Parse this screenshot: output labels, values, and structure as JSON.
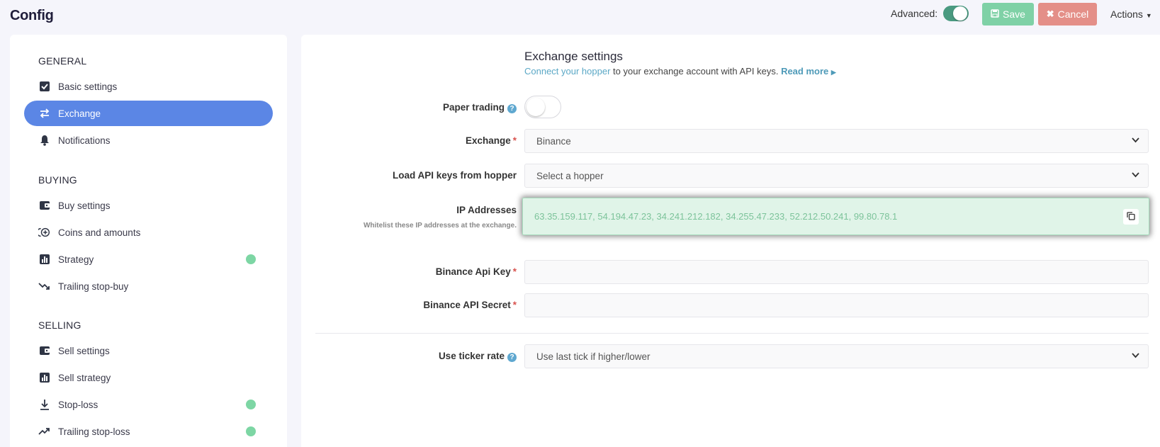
{
  "header": {
    "title": "Config",
    "advanced_label": "Advanced:",
    "save_label": "Save",
    "cancel_label": "Cancel",
    "actions_label": "Actions"
  },
  "sidebar": {
    "general_title": "GENERAL",
    "buying_title": "BUYING",
    "selling_title": "SELLING",
    "items": [
      {
        "label": "Basic settings",
        "icon": "checkbox-icon"
      },
      {
        "label": "Exchange",
        "icon": "swap-arrows-icon",
        "active": true
      },
      {
        "label": "Notifications",
        "icon": "bell-icon"
      },
      {
        "label": "Buy settings",
        "icon": "wallet-icon"
      },
      {
        "label": "Coins and amounts",
        "icon": "coins-plus-icon"
      },
      {
        "label": "Strategy",
        "icon": "bar-chart-icon",
        "status": "green"
      },
      {
        "label": "Trailing stop-buy",
        "icon": "trend-down-icon"
      },
      {
        "label": "Sell settings",
        "icon": "wallet-icon"
      },
      {
        "label": "Sell strategy",
        "icon": "bar-chart-icon"
      },
      {
        "label": "Stop-loss",
        "icon": "download-arrow-icon",
        "status": "green"
      },
      {
        "label": "Trailing stop-loss",
        "icon": "trend-up-icon",
        "status": "green"
      }
    ]
  },
  "main": {
    "title": "Exchange settings",
    "subtitle_link": "Connect your hopper",
    "subtitle_text": " to your exchange account with API keys. ",
    "read_more": "Read more",
    "paper_trading_label": "Paper trading",
    "exchange_label": "Exchange",
    "exchange_value": "Binance",
    "load_keys_label": "Load API keys from hopper",
    "load_keys_placeholder": "Select a hopper",
    "ip_label": "IP Addresses",
    "ip_sublabel": "Whitelist these IP addresses at the exchange.",
    "ip_value": "63.35.159.117, 54.194.47.23, 34.241.212.182, 34.255.47.233, 52.212.50.241, 99.80.78.1",
    "api_key_label": "Binance Api Key",
    "api_key_value": "",
    "api_secret_label": "Binance API Secret",
    "api_secret_value": "",
    "ticker_label": "Use ticker rate",
    "ticker_value": "Use last tick if higher/lower"
  },
  "colors": {
    "accent": "#5b86e5",
    "save": "#7fd1a6",
    "cancel": "#e48f88",
    "status_green": "#7dd6a4",
    "toggle_on": "#4a9a80"
  }
}
